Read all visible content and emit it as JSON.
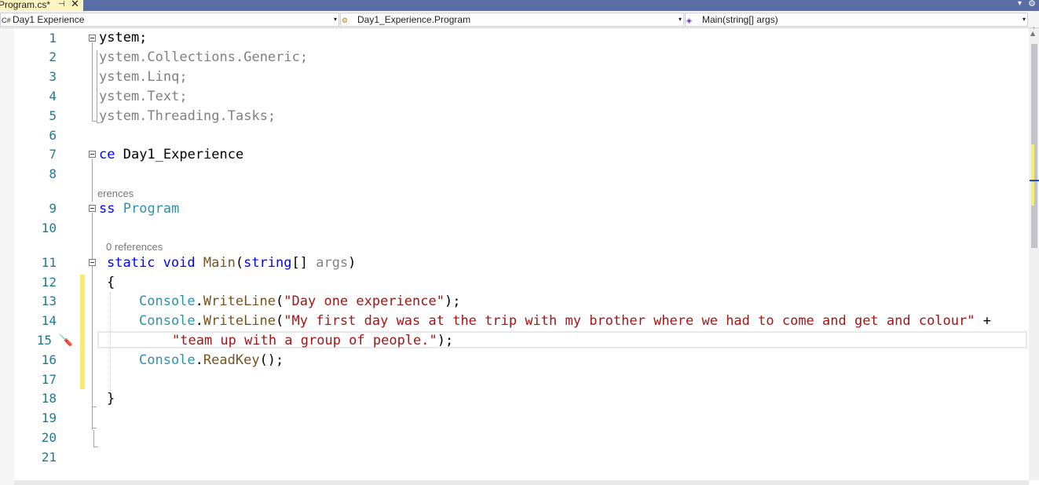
{
  "tab": {
    "title": "Program.cs*",
    "pin_icon": "pin-icon",
    "close_icon": "close-icon",
    "close_glyph": "✕",
    "pin_glyph": "⊣"
  },
  "navbar": {
    "project": {
      "label": "Day1 Experience",
      "icon": "csharp-project-icon"
    },
    "class": {
      "label": "Day1_Experience.Program",
      "icon": "class-icon"
    },
    "member": {
      "label": "Main(string[] args)",
      "icon": "method-icon"
    },
    "dropdown_glyph": "▾",
    "split_glyph": "+"
  },
  "editor": {
    "line_numbers": [
      "1",
      "2",
      "3",
      "4",
      "5",
      "6",
      "7",
      "8",
      "9",
      "10",
      "11",
      "12",
      "13",
      "14",
      "15",
      "16",
      "17",
      "18",
      "19",
      "20",
      "21"
    ],
    "codelens": {
      "class_refs": "erences",
      "method_refs": "0 references"
    },
    "code": {
      "l1": "ystem;",
      "l2": "ystem.Collections.Generic;",
      "l3": "ystem.Linq;",
      "l4": "ystem.Text;",
      "l5": "ystem.Threading.Tasks;",
      "l7_kw": "ce",
      "l7_name": " Day1_Experience",
      "l9_kw": "ss",
      "l9_name": "Program",
      "l11_static": "static",
      "l11_void": "void",
      "l11_main": "Main",
      "l11_paren": "(",
      "l11_string": "string",
      "l11_arr": "[] ",
      "l11_args": "args",
      "l11_close": ")",
      "l12": "{",
      "l13_console": "Console",
      "l13_dot": ".",
      "l13_method": "WriteLine",
      "l13_open": "(",
      "l13_str": "\"Day one experience\"",
      "l13_close": ");",
      "l14_console": "Console",
      "l14_dot": ".",
      "l14_method": "WriteLine",
      "l14_open": "(",
      "l14_str": "\"My first day was at the trip with my brother where we had to come and get and colour\"",
      "l14_plus": " +",
      "l15_str": "\"team up with a group of people.\"",
      "l15_close": ");",
      "l16_console": "Console",
      "l16_dot": ".",
      "l16_method": "ReadKey",
      "l16_close": "();",
      "l18": "}"
    },
    "quick_action_icon": "screwdriver-icon",
    "quick_action_glyph": "🪛"
  },
  "colors": {
    "keyword": "#0000ff",
    "type": "#2b91af",
    "method": "#74531f",
    "string": "#a31515",
    "line_number": "#237893",
    "change_marker": "#f5ed6f",
    "tab_active": "#fdf4bf",
    "tabbar": "#5a6ea5"
  }
}
